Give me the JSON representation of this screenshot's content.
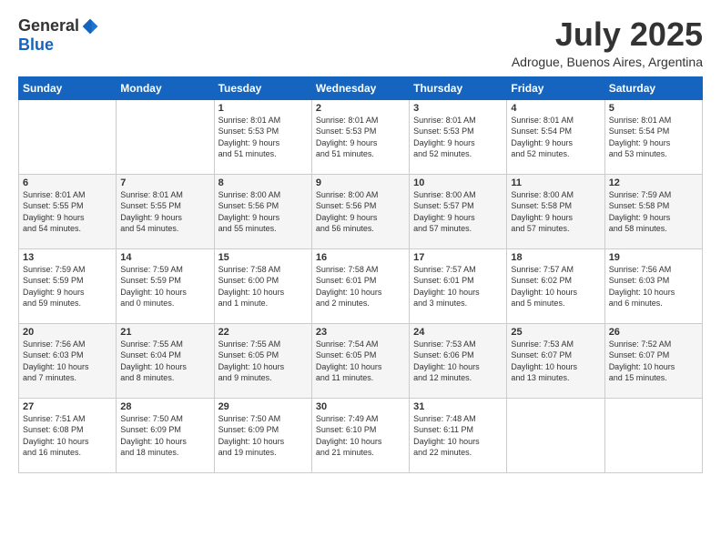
{
  "logo": {
    "general": "General",
    "blue": "Blue"
  },
  "title": "July 2025",
  "location": "Adrogue, Buenos Aires, Argentina",
  "weekdays": [
    "Sunday",
    "Monday",
    "Tuesday",
    "Wednesday",
    "Thursday",
    "Friday",
    "Saturday"
  ],
  "weeks": [
    [
      {
        "day": "",
        "info": ""
      },
      {
        "day": "",
        "info": ""
      },
      {
        "day": "1",
        "info": "Sunrise: 8:01 AM\nSunset: 5:53 PM\nDaylight: 9 hours\nand 51 minutes."
      },
      {
        "day": "2",
        "info": "Sunrise: 8:01 AM\nSunset: 5:53 PM\nDaylight: 9 hours\nand 51 minutes."
      },
      {
        "day": "3",
        "info": "Sunrise: 8:01 AM\nSunset: 5:53 PM\nDaylight: 9 hours\nand 52 minutes."
      },
      {
        "day": "4",
        "info": "Sunrise: 8:01 AM\nSunset: 5:54 PM\nDaylight: 9 hours\nand 52 minutes."
      },
      {
        "day": "5",
        "info": "Sunrise: 8:01 AM\nSunset: 5:54 PM\nDaylight: 9 hours\nand 53 minutes."
      }
    ],
    [
      {
        "day": "6",
        "info": "Sunrise: 8:01 AM\nSunset: 5:55 PM\nDaylight: 9 hours\nand 54 minutes."
      },
      {
        "day": "7",
        "info": "Sunrise: 8:01 AM\nSunset: 5:55 PM\nDaylight: 9 hours\nand 54 minutes."
      },
      {
        "day": "8",
        "info": "Sunrise: 8:00 AM\nSunset: 5:56 PM\nDaylight: 9 hours\nand 55 minutes."
      },
      {
        "day": "9",
        "info": "Sunrise: 8:00 AM\nSunset: 5:56 PM\nDaylight: 9 hours\nand 56 minutes."
      },
      {
        "day": "10",
        "info": "Sunrise: 8:00 AM\nSunset: 5:57 PM\nDaylight: 9 hours\nand 57 minutes."
      },
      {
        "day": "11",
        "info": "Sunrise: 8:00 AM\nSunset: 5:58 PM\nDaylight: 9 hours\nand 57 minutes."
      },
      {
        "day": "12",
        "info": "Sunrise: 7:59 AM\nSunset: 5:58 PM\nDaylight: 9 hours\nand 58 minutes."
      }
    ],
    [
      {
        "day": "13",
        "info": "Sunrise: 7:59 AM\nSunset: 5:59 PM\nDaylight: 9 hours\nand 59 minutes."
      },
      {
        "day": "14",
        "info": "Sunrise: 7:59 AM\nSunset: 5:59 PM\nDaylight: 10 hours\nand 0 minutes."
      },
      {
        "day": "15",
        "info": "Sunrise: 7:58 AM\nSunset: 6:00 PM\nDaylight: 10 hours\nand 1 minute."
      },
      {
        "day": "16",
        "info": "Sunrise: 7:58 AM\nSunset: 6:01 PM\nDaylight: 10 hours\nand 2 minutes."
      },
      {
        "day": "17",
        "info": "Sunrise: 7:57 AM\nSunset: 6:01 PM\nDaylight: 10 hours\nand 3 minutes."
      },
      {
        "day": "18",
        "info": "Sunrise: 7:57 AM\nSunset: 6:02 PM\nDaylight: 10 hours\nand 5 minutes."
      },
      {
        "day": "19",
        "info": "Sunrise: 7:56 AM\nSunset: 6:03 PM\nDaylight: 10 hours\nand 6 minutes."
      }
    ],
    [
      {
        "day": "20",
        "info": "Sunrise: 7:56 AM\nSunset: 6:03 PM\nDaylight: 10 hours\nand 7 minutes."
      },
      {
        "day": "21",
        "info": "Sunrise: 7:55 AM\nSunset: 6:04 PM\nDaylight: 10 hours\nand 8 minutes."
      },
      {
        "day": "22",
        "info": "Sunrise: 7:55 AM\nSunset: 6:05 PM\nDaylight: 10 hours\nand 9 minutes."
      },
      {
        "day": "23",
        "info": "Sunrise: 7:54 AM\nSunset: 6:05 PM\nDaylight: 10 hours\nand 11 minutes."
      },
      {
        "day": "24",
        "info": "Sunrise: 7:53 AM\nSunset: 6:06 PM\nDaylight: 10 hours\nand 12 minutes."
      },
      {
        "day": "25",
        "info": "Sunrise: 7:53 AM\nSunset: 6:07 PM\nDaylight: 10 hours\nand 13 minutes."
      },
      {
        "day": "26",
        "info": "Sunrise: 7:52 AM\nSunset: 6:07 PM\nDaylight: 10 hours\nand 15 minutes."
      }
    ],
    [
      {
        "day": "27",
        "info": "Sunrise: 7:51 AM\nSunset: 6:08 PM\nDaylight: 10 hours\nand 16 minutes."
      },
      {
        "day": "28",
        "info": "Sunrise: 7:50 AM\nSunset: 6:09 PM\nDaylight: 10 hours\nand 18 minutes."
      },
      {
        "day": "29",
        "info": "Sunrise: 7:50 AM\nSunset: 6:09 PM\nDaylight: 10 hours\nand 19 minutes."
      },
      {
        "day": "30",
        "info": "Sunrise: 7:49 AM\nSunset: 6:10 PM\nDaylight: 10 hours\nand 21 minutes."
      },
      {
        "day": "31",
        "info": "Sunrise: 7:48 AM\nSunset: 6:11 PM\nDaylight: 10 hours\nand 22 minutes."
      },
      {
        "day": "",
        "info": ""
      },
      {
        "day": "",
        "info": ""
      }
    ]
  ]
}
